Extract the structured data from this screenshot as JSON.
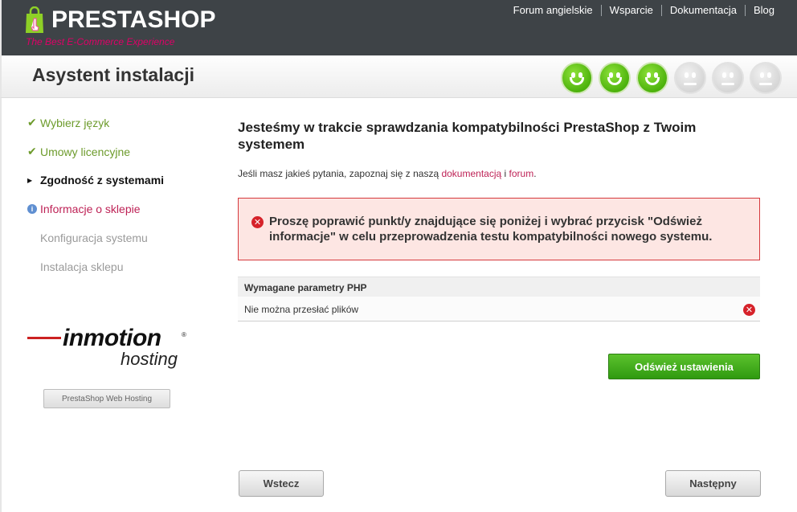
{
  "header": {
    "logo_text": "PRESTASHOP",
    "logo_tagline": "The Best E-Commerce Experience",
    "nav": [
      "Forum angielskie",
      "Wsparcie",
      "Dokumentacja",
      "Blog"
    ]
  },
  "title_band": {
    "title": "Asystent instalacji",
    "progress_steps_total": 6,
    "progress_steps_done": 3
  },
  "sidebar": {
    "steps": [
      {
        "label": "Wybierz język",
        "state": "done"
      },
      {
        "label": "Umowy licencyjne",
        "state": "done"
      },
      {
        "label": "Zgodność z systemami",
        "state": "current"
      },
      {
        "label": "Informacje o sklepie",
        "state": "info"
      },
      {
        "label": "Konfiguracja systemu",
        "state": "todo"
      },
      {
        "label": "Instalacja sklepu",
        "state": "todo"
      }
    ],
    "partner_logo": "inmotion",
    "partner_sub": "hosting",
    "partner_button": "PrestaShop Web Hosting"
  },
  "main": {
    "title": "Jesteśmy w trakcie sprawdzania kompatybilności PrestaShop z Twoim systemem",
    "help_prefix": "Jeśli masz jakieś pytania, zapoznaj się z naszą ",
    "help_link1": "dokumentacją",
    "help_mid": " i ",
    "help_link2": "forum",
    "help_suffix": ".",
    "error_message": "Proszę poprawić punkt/y znajdujące się poniżej i wybrać przycisk \"Odśwież informacje\" w celu przeprowadzenia testu kompatybilności nowego systemu.",
    "php_table": {
      "header": "Wymagane parametry PHP",
      "rows": [
        "Nie można przesłać plików"
      ]
    },
    "refresh_button": "Odśwież ustawienia",
    "back_button": "Wstecz",
    "next_button": "Następny"
  },
  "colors": {
    "header_bg": "#3e4347",
    "accent_pink": "#be2256",
    "done_green": "#6d9b2c",
    "error_red": "#d6393d",
    "button_green": "#3faa17"
  }
}
